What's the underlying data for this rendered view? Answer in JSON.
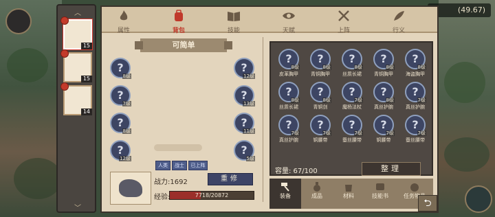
{
  "hud": {
    "top_right_value": "(49.67)"
  },
  "character_slots": [
    {
      "level": "15",
      "selected": true
    },
    {
      "level": "15",
      "selected": false
    },
    {
      "level": "14",
      "selected": false
    }
  ],
  "tabs": [
    {
      "label": "属性",
      "icon": "flame-icon",
      "active": false
    },
    {
      "label": "背包",
      "icon": "backpack-icon",
      "active": true
    },
    {
      "label": "技能",
      "icon": "book-icon",
      "active": false
    },
    {
      "label": "天赋",
      "icon": "eye-icon",
      "active": false
    },
    {
      "label": "上阵",
      "icon": "crossed-swords-icon",
      "active": false
    },
    {
      "label": "行义",
      "icon": "feather-icon",
      "active": false
    }
  ],
  "left": {
    "title": "可简单",
    "left_slots": [
      {
        "level": "8级"
      },
      {
        "level": "7级"
      },
      {
        "level": "8级"
      },
      {
        "level": "12级"
      }
    ],
    "right_slots": [
      {
        "level": "12级"
      },
      {
        "level": "13级"
      },
      {
        "level": "11级"
      },
      {
        "level": "5级"
      }
    ],
    "mini_buttons": [
      "人类",
      "战士",
      "已上阵"
    ],
    "power": "战力:1692",
    "rebuild_label": "重修",
    "exp_label": "经验:",
    "exp_text": "7718/20872",
    "exp_progress": 0.37
  },
  "inventory": {
    "items": [
      {
        "name": "皮革胸甲",
        "level": "8级"
      },
      {
        "name": "青铜胸甲",
        "level": "8级"
      },
      {
        "name": "丝质长裙",
        "level": "8级"
      },
      {
        "name": "青铜胸甲",
        "level": "8级"
      },
      {
        "name": "海盗胸甲",
        "level": "8级"
      },
      {
        "name": "丝质长裙",
        "level": "8级"
      },
      {
        "name": "青铜剑",
        "level": "8级"
      },
      {
        "name": "魔杨法杖",
        "level": "7级"
      },
      {
        "name": "真丝护腕",
        "level": "8级"
      },
      {
        "name": "真丝护腕",
        "level": "7级"
      },
      {
        "name": "真丝护腕",
        "level": "7级"
      },
      {
        "name": "铜腰带",
        "level": "7级"
      },
      {
        "name": "蚕丝腰带",
        "level": "7级"
      },
      {
        "name": "铜腰带",
        "level": "7级"
      },
      {
        "name": "蚕丝腰带",
        "level": "7级"
      }
    ],
    "capacity": "容量:  67/100",
    "sort_label": "整理",
    "categories": [
      {
        "label": "装备",
        "icon": "hammer-icon",
        "active": true
      },
      {
        "label": "成品",
        "icon": "potion-icon",
        "active": false
      },
      {
        "label": "材料",
        "icon": "bag-icon",
        "active": false
      },
      {
        "label": "技能书",
        "icon": "scroll-icon",
        "active": false
      },
      {
        "label": "任务物品",
        "icon": "bundle-icon",
        "active": false
      }
    ]
  },
  "colors": {
    "accent_active": "#c0392b",
    "slot_ring": "#8fa0be",
    "exp_fill": "#9b2f2a"
  }
}
